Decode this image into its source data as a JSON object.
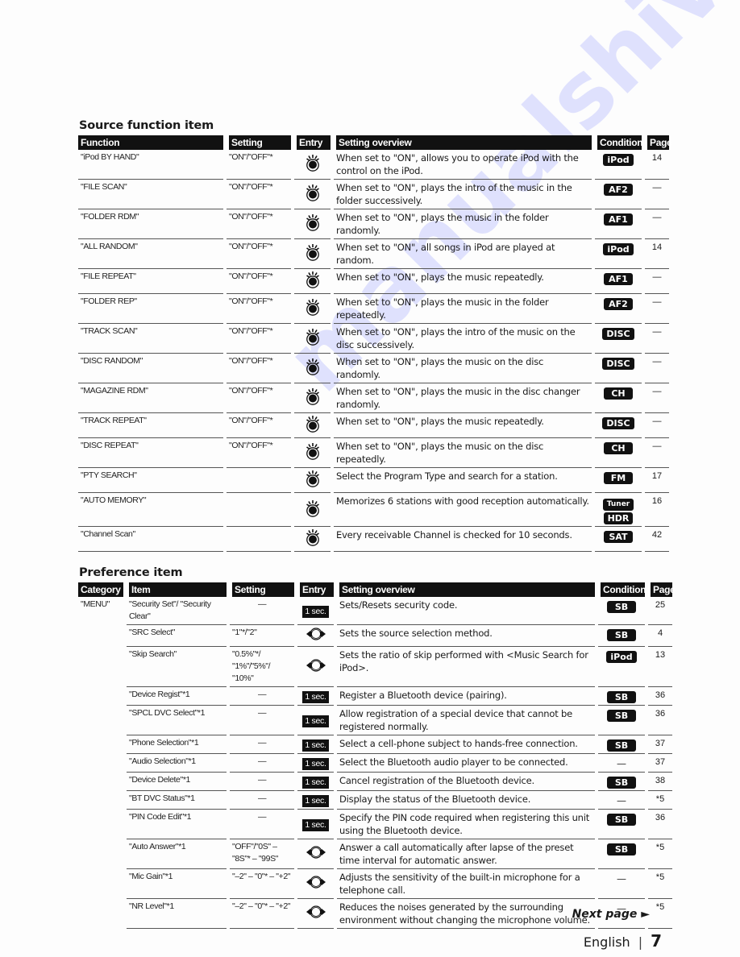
{
  "watermark": "manualshive.com",
  "source_section": {
    "title": "Source function item",
    "headers": [
      "Function",
      "Setting",
      "Entry",
      "Setting overview",
      "Condition",
      "Page"
    ],
    "rows": [
      {
        "function": "\"iPod BY HAND\"",
        "setting": "\"ON\"/\"OFF\"*",
        "entry": "knob",
        "overview": "When set to \"ON\", allows you to operate iPod with the control on the iPod.",
        "condition": [
          "iPod"
        ],
        "page": "14"
      },
      {
        "function": "\"FILE SCAN\"",
        "setting": "\"ON\"/\"OFF\"*",
        "entry": "knob",
        "overview": "When set to \"ON\", plays the intro of the music in the folder successively.",
        "condition": [
          "AF2"
        ],
        "page": "—"
      },
      {
        "function": "\"FOLDER RDM\"",
        "setting": "\"ON\"/\"OFF\"*",
        "entry": "knob",
        "overview": "When set to \"ON\", plays the music in the folder randomly.",
        "condition": [
          "AF1"
        ],
        "page": "—"
      },
      {
        "function": "\"ALL RANDOM\"",
        "setting": "\"ON\"/\"OFF\"*",
        "entry": "knob",
        "overview": "When set to \"ON\", all songs in iPod are played at random.",
        "condition": [
          "iPod"
        ],
        "page": "14"
      },
      {
        "function": "\"FILE REPEAT\"",
        "setting": "\"ON\"/\"OFF\"*",
        "entry": "knob",
        "overview": "When set to \"ON\", plays the music repeatedly.",
        "condition": [
          "AF1"
        ],
        "page": "—"
      },
      {
        "function": "\"FOLDER REP\"",
        "setting": "\"ON\"/\"OFF\"*",
        "entry": "knob",
        "overview": "When set to \"ON\", plays the music in the folder repeatedly.",
        "condition": [
          "AF2"
        ],
        "page": "—"
      },
      {
        "function": "\"TRACK SCAN\"",
        "setting": "\"ON\"/\"OFF\"*",
        "entry": "knob",
        "overview": "When set to \"ON\", plays the intro of the music on the disc successively.",
        "condition": [
          "DISC"
        ],
        "page": "—"
      },
      {
        "function": "\"DISC RANDOM\"",
        "setting": "\"ON\"/\"OFF\"*",
        "entry": "knob",
        "overview": "When set to \"ON\", plays the music on the disc randomly.",
        "condition": [
          "DISC"
        ],
        "page": "—"
      },
      {
        "function": "\"MAGAZINE RDM\"",
        "setting": "\"ON\"/\"OFF\"*",
        "entry": "knob",
        "overview": "When set to \"ON\", plays the music in the disc changer randomly.",
        "condition": [
          "CH"
        ],
        "page": "—"
      },
      {
        "function": "\"TRACK REPEAT\"",
        "setting": "\"ON\"/\"OFF\"*",
        "entry": "knob",
        "overview": "When set to \"ON\", plays the music repeatedly.",
        "condition": [
          "DISC"
        ],
        "page": "—"
      },
      {
        "function": "\"DISC REPEAT\"",
        "setting": "\"ON\"/\"OFF\"*",
        "entry": "knob",
        "overview": "When set to \"ON\", plays the music on the disc repeatedly.",
        "condition": [
          "CH"
        ],
        "page": "—"
      },
      {
        "function": "\"PTY SEARCH\"",
        "setting": "",
        "entry": "knob",
        "overview": "Select the Program Type and search for a station.",
        "condition": [
          "FM"
        ],
        "page": "17"
      },
      {
        "function": "\"AUTO MEMORY\"",
        "setting": "",
        "entry": "knob",
        "overview": "Memorizes 6 stations with good reception automatically.",
        "condition": [
          "Tuner",
          "HDR"
        ],
        "page": "16"
      },
      {
        "function": "\"Channel Scan\"",
        "setting": "",
        "entry": "knob",
        "overview": "Every receivable Channel is checked for 10 seconds.",
        "condition": [
          "SAT"
        ],
        "page": "42"
      }
    ]
  },
  "preference_section": {
    "title": "Preference item",
    "headers": [
      "Category",
      "Item",
      "Setting",
      "Entry",
      "Setting overview",
      "Condition",
      "Page"
    ],
    "category": "\"MENU\"",
    "rows": [
      {
        "item": "\"Security Set\"/ \"Security Clear\"",
        "setting": "—",
        "entry": "1 sec.",
        "overview": "Sets/Resets security code.",
        "condition": [
          "SB"
        ],
        "page": "25"
      },
      {
        "item": "\"SRC Select\"",
        "setting": "\"1\"*/\"2\"",
        "entry": "left-right",
        "overview": "Sets the source selection method.",
        "condition": [
          "SB"
        ],
        "page": "4"
      },
      {
        "item": "\"Skip Search\"",
        "setting": "\"0.5%\"*/ \"1%\"/\"5%\"/ \"10%\"",
        "entry": "left-right",
        "overview": "Sets the ratio of skip performed with <Music Search for iPod>.",
        "condition": [
          "iPod"
        ],
        "page": "13"
      },
      {
        "item": "\"Device Regist\"*1",
        "setting": "—",
        "entry": "1 sec.",
        "overview": "Register a Bluetooth device (pairing).",
        "condition": [
          "SB"
        ],
        "page": "36"
      },
      {
        "item": "\"SPCL DVC Select\"*1",
        "setting": "—",
        "entry": "1 sec.",
        "overview": "Allow registration of a special device that cannot be registered normally.",
        "condition": [
          "SB"
        ],
        "page": "36"
      },
      {
        "item": "\"Phone Selection\"*1",
        "setting": "—",
        "entry": "1 sec.",
        "overview": "Select a cell-phone subject to hands-free connection.",
        "condition": [
          "SB"
        ],
        "page": "37"
      },
      {
        "item": "\"Audio Selection\"*1",
        "setting": "—",
        "entry": "1 sec.",
        "overview": "Select the Bluetooth audio player to be connected.",
        "condition": [],
        "page": "37"
      },
      {
        "item": "\"Device Delete\"*1",
        "setting": "—",
        "entry": "1 sec.",
        "overview": "Cancel registration of the Bluetooth device.",
        "condition": [
          "SB"
        ],
        "page": "38"
      },
      {
        "item": "\"BT DVC Status\"*1",
        "setting": "—",
        "entry": "1 sec.",
        "overview": "Display the status of the Bluetooth device.",
        "condition": [],
        "page": "*5"
      },
      {
        "item": "\"PIN Code Edit\"*1",
        "setting": "—",
        "entry": "1 sec.",
        "overview": "Specify the PIN code required when registering this unit using the Bluetooth device.",
        "condition": [
          "SB"
        ],
        "page": "36"
      },
      {
        "item": "\"Auto Answer\"*1",
        "setting": "\"OFF\"/\"0S\" – \"8S\"* – \"99S\"",
        "entry": "left-right",
        "overview": "Answer a call automatically after lapse of the preset time interval for automatic answer.",
        "condition": [
          "SB"
        ],
        "page": "*5"
      },
      {
        "item": "\"Mic Gain\"*1",
        "setting": "\"–2\" – \"0\"* – \"+2\"",
        "entry": "left-right",
        "overview": "Adjusts the sensitivity of the built-in microphone for a telephone call.",
        "condition": [],
        "page": "*5"
      },
      {
        "item": "\"NR Level\"*1",
        "setting": "\"–2\" – \"0\"* – \"+2\"",
        "entry": "left-right",
        "overview": "Reduces the noises generated by the surrounding environment without changing the microphone volume.",
        "condition": [],
        "page": "*5"
      }
    ]
  },
  "footer": {
    "next_page": "Next page ►",
    "language": "English",
    "separator": "|",
    "page_number": "7"
  },
  "labels": {
    "none": "—"
  }
}
